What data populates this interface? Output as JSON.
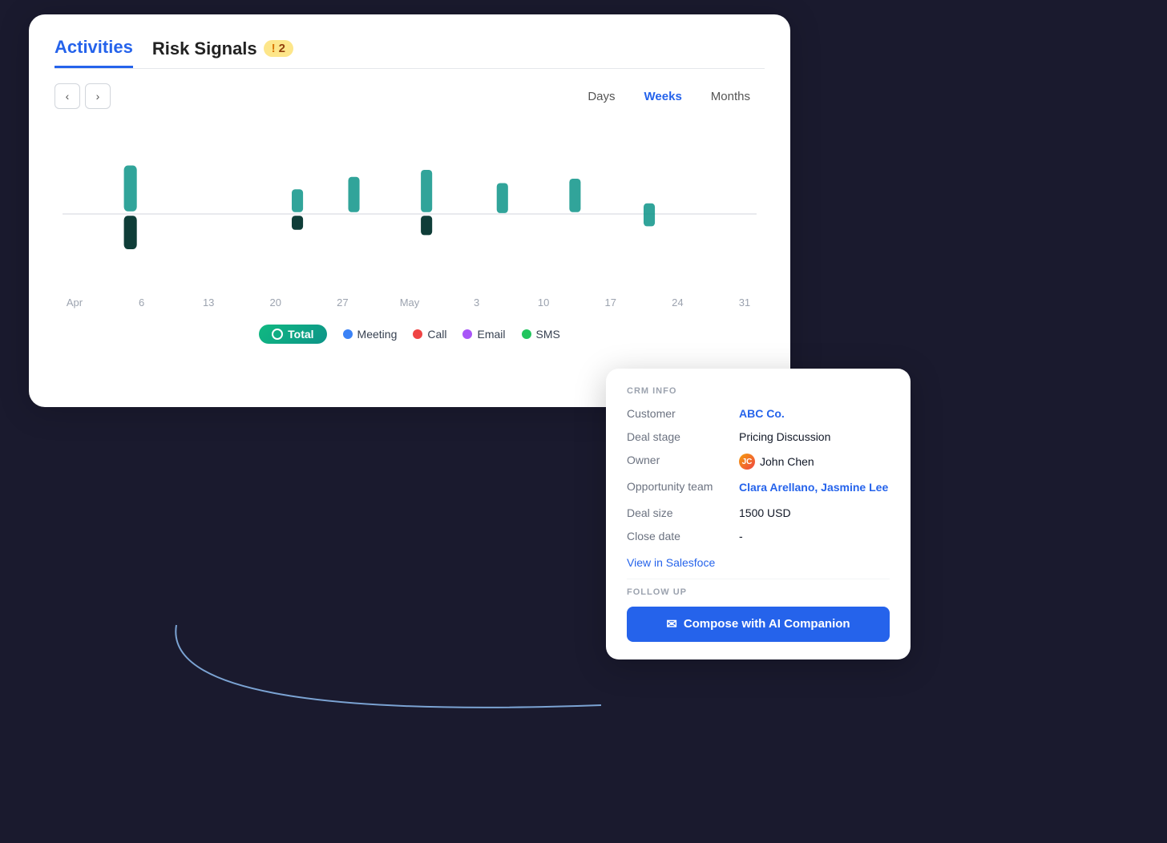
{
  "tabs": {
    "activities": "Activities",
    "risk_signals": "Risk Signals",
    "risk_count": "2"
  },
  "chart_controls": {
    "prev_label": "‹",
    "next_label": "›",
    "view_options": [
      "Days",
      "Weeks",
      "Months"
    ],
    "active_view": "Weeks"
  },
  "x_axis_labels": [
    "Apr",
    "6",
    "13",
    "20",
    "27",
    "May",
    "3",
    "10",
    "17",
    "24",
    "31"
  ],
  "legend": {
    "total": "Total",
    "meeting": "Meeting",
    "call": "Call",
    "email": "Email",
    "sms": "SMS"
  },
  "legend_colors": {
    "meeting": "#3b82f6",
    "call": "#ef4444",
    "email": "#a855f7",
    "sms": "#22c55e"
  },
  "crm": {
    "section_label": "CRM INFO",
    "customer_label": "Customer",
    "customer_value": "ABC Co.",
    "deal_stage_label": "Deal stage",
    "deal_stage_value": "Pricing Discussion",
    "owner_label": "Owner",
    "owner_value": "John Chen",
    "opp_team_label": "Opportunity team",
    "opp_team_value": "Clara Arellano, Jasmine Lee",
    "deal_size_label": "Deal size",
    "deal_size_value": "1500 USD",
    "close_date_label": "Close date",
    "close_date_value": "-",
    "view_link": "View in Salesfoce"
  },
  "follow_up": {
    "section_label": "FOLLOW UP",
    "compose_label": "Compose with AI Companion"
  },
  "chart_bars": [
    {
      "x": 13,
      "top_h": 55,
      "bottom_h": 30,
      "dark": true
    },
    {
      "x": 39,
      "top_h": 20,
      "bottom_h": 16,
      "dark": false
    },
    {
      "x": 55,
      "top_h": 38,
      "bottom_h": 0,
      "dark": false
    },
    {
      "x": 66,
      "top_h": 44,
      "bottom_h": 22,
      "dark": true
    },
    {
      "x": 79,
      "top_h": 30,
      "bottom_h": 0,
      "dark": false
    },
    {
      "x": 92,
      "top_h": 32,
      "bottom_h": 0,
      "dark": false
    },
    {
      "x": 82,
      "top_h": 10,
      "bottom_h": 60,
      "dark": false
    }
  ]
}
